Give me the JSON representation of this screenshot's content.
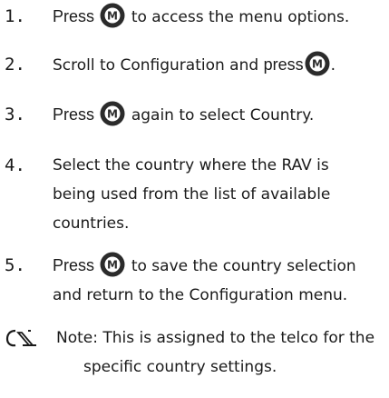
{
  "steps": [
    {
      "number": "1.",
      "press": "Press",
      "after": "to access the menu options."
    },
    {
      "number": "2.",
      "before": "Scroll to Configuration and",
      "press": "press",
      "after": "."
    },
    {
      "number": "3.",
      "press": "Press",
      "after": "again to select Country."
    },
    {
      "number": "4.",
      "lines": [
        "Select the country where the RAV is",
        "being used from the list of available",
        "countries."
      ]
    },
    {
      "number": "5.",
      "press": "Press",
      "after": "to save the country selection",
      "line2": "and return to the Configuration menu."
    }
  ],
  "note": {
    "icon": "note-icon",
    "label": "Note:",
    "line1": "This is assigned to the telco for the",
    "line2": "specific country settings."
  },
  "button_icon": {
    "name": "m-button-icon",
    "letter": "M"
  },
  "colors": {
    "text": "#1a1a1a",
    "button": "#2b2b2b"
  }
}
